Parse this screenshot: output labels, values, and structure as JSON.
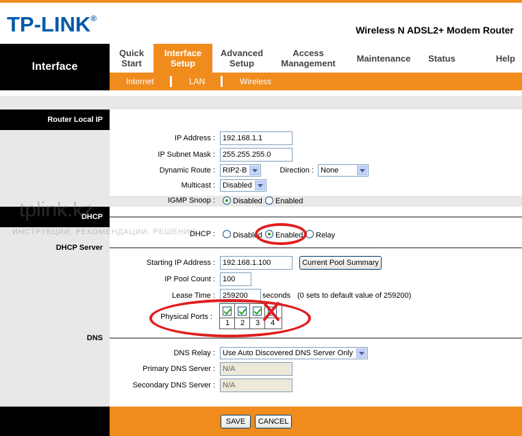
{
  "header": {
    "brand": "TP-LINK",
    "brand_mark": "®",
    "model": "Wireless N ADSL2+ Modem Router"
  },
  "nav": {
    "section_title": "Interface",
    "items": [
      {
        "line1": "Quick",
        "line2": "Start"
      },
      {
        "line1": "Interface",
        "line2": "Setup",
        "active": true
      },
      {
        "line1": "Advanced",
        "line2": "Setup"
      },
      {
        "line1": "Access",
        "line2": "Management"
      },
      {
        "line1": "Maintenance",
        "line2": ""
      },
      {
        "line1": "Status",
        "line2": ""
      },
      {
        "line1": "Help",
        "line2": ""
      }
    ],
    "sub_items": [
      "Internet",
      "LAN",
      "Wireless"
    ]
  },
  "sections": {
    "router_local_ip": "Router Local IP",
    "dhcp": "DHCP",
    "dhcp_server": "DHCP Server",
    "dns": "DNS"
  },
  "router": {
    "ip_address_label": "IP Address :",
    "ip_address": "192.168.1.1",
    "subnet_label": "IP Subnet Mask :",
    "subnet": "255.255.255.0",
    "dynamic_route_label": "Dynamic Route :",
    "dynamic_route": "RIP2-B",
    "direction_label": "Direction :",
    "direction": "None",
    "multicast_label": "Multicast :",
    "multicast": "Disabled",
    "igmp_label": "IGMP Snoop :",
    "igmp_disabled": "Disabled",
    "igmp_enabled": "Enabled"
  },
  "dhcp": {
    "label": "DHCP :",
    "opt_disabled": "Disabled",
    "opt_enabled": "Enabled",
    "opt_relay": "Relay",
    "selected": "Enabled"
  },
  "dhcp_server": {
    "start_ip_label": "Starting IP Address :",
    "start_ip": "192.168.1.100",
    "pool_button": "Current Pool Summary",
    "pool_count_label": "IP Pool Count :",
    "pool_count": "100",
    "lease_label": "Lease Time :",
    "lease_value": "259200",
    "lease_unit": "seconds",
    "lease_hint": "(0 sets to default value of 259200)",
    "ports_label": "Physical Ports :",
    "ports": [
      {
        "num": "1",
        "checked": true
      },
      {
        "num": "2",
        "checked": true
      },
      {
        "num": "3",
        "checked": true
      },
      {
        "num": "4",
        "checked": false
      }
    ]
  },
  "dns": {
    "relay_label": "DNS Relay :",
    "relay_value": "Use Auto Discovered DNS Server Only",
    "primary_label": "Primary DNS Server :",
    "primary_value": "N/A",
    "secondary_label": "Secondary DNS Server :",
    "secondary_value": "N/A"
  },
  "footer": {
    "save": "SAVE",
    "cancel": "CANCEL"
  },
  "watermark": {
    "main": "tplink.kz",
    "sub": "ИНСТРУКЦИИ, РЕКОМЕНДАЦИИ, РЕШЕНИЯ"
  },
  "colors": {
    "accent": "#f08c1e",
    "brand": "#005aa8",
    "annotation": "#e01e1e"
  }
}
